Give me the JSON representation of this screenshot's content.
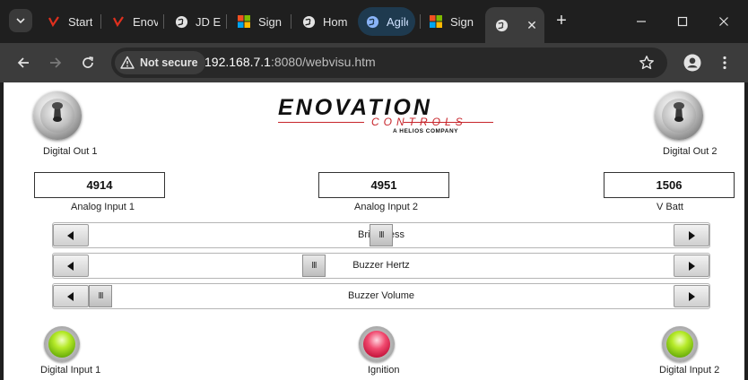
{
  "browser": {
    "tabs": [
      {
        "title": "Start",
        "icon": "enovation-icon"
      },
      {
        "title": "Enov",
        "icon": "enovation-icon"
      },
      {
        "title": "JD E",
        "icon": "globe-icon"
      },
      {
        "title": "Sign",
        "icon": "microsoft-icon"
      },
      {
        "title": "Hom",
        "icon": "globe-icon"
      },
      {
        "title": "Agile",
        "icon": "globe-icon"
      },
      {
        "title": "Sign",
        "icon": "microsoft-icon"
      },
      {
        "title": "",
        "icon": "globe-icon"
      }
    ],
    "security_label": "Not secure",
    "url_host": "192.168.7.1",
    "url_path": ":8080/webvisu.htm",
    "colors": {
      "chrome": "#1f1f1f",
      "toolbar": "#3c3c3c",
      "accent": "#8ab4f8"
    }
  },
  "page": {
    "logo": {
      "main": "ENOVATION",
      "sub": "CONTROLS",
      "tagline": "A HELIOS COMPANY"
    },
    "digital_outputs": [
      {
        "label": "Digital Out 1"
      },
      {
        "label": "Digital Out 2"
      }
    ],
    "readouts": [
      {
        "value": "4914",
        "label": "Analog Input 1"
      },
      {
        "value": "4951",
        "label": "Analog Input 2"
      },
      {
        "value": "1506",
        "label": "V Batt"
      }
    ],
    "sliders": [
      {
        "caption": "Brightness",
        "thumb": "III",
        "level": 0.5
      },
      {
        "caption": "Buzzer Hertz",
        "thumb": "III",
        "level": 0.38
      },
      {
        "caption": "Buzzer Volume",
        "thumb": "III",
        "level": 0.0
      }
    ],
    "lamps": [
      {
        "label": "Digital Input 1",
        "state": "on",
        "color": "#9bd21a"
      },
      {
        "label": "Ignition",
        "state": "on",
        "color": "#e8234f"
      },
      {
        "label": "Digital Input 2",
        "state": "on",
        "color": "#9bd21a"
      }
    ]
  }
}
